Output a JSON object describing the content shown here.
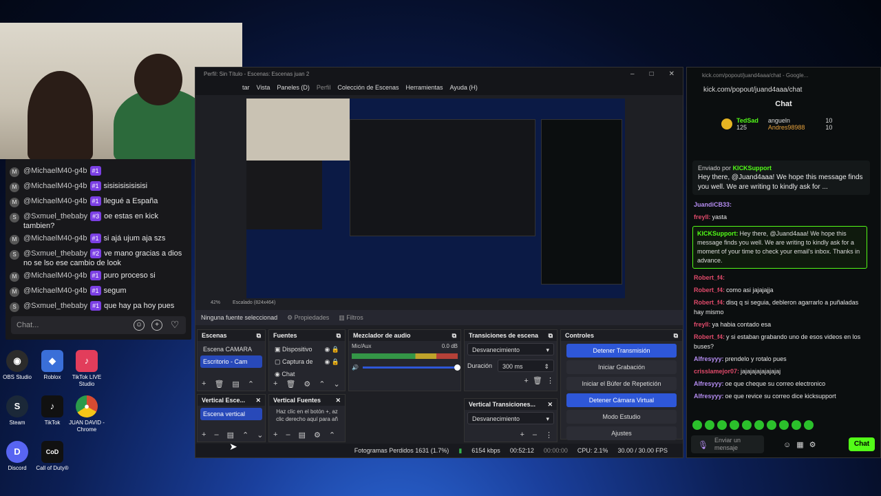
{
  "left_chat": {
    "messages": [
      {
        "user": "@MichaelM40-g4b",
        "badge": "#1",
        "text": ""
      },
      {
        "user": "@MichaelM40-g4b",
        "badge": "#1",
        "text": "sisisisisisisisi"
      },
      {
        "user": "@MichaelM40-g4b",
        "badge": "#1",
        "text": "llegué a España"
      },
      {
        "user": "@Sxmuel_thebaby",
        "badge": "#3",
        "text": "oe estas en kick tambien?"
      },
      {
        "user": "@MichaelM40-g4b",
        "badge": "#1",
        "text": "si ajá ujum aja szs"
      },
      {
        "user": "@Sxmuel_thebaby",
        "badge": "#2",
        "text": "ve mano gracias a dios no se lso ese cambio de look"
      },
      {
        "user": "@MichaelM40-g4b",
        "badge": "#1",
        "text": "puro proceso si"
      },
      {
        "user": "@MichaelM40-g4b",
        "badge": "#1",
        "text": "segum"
      },
      {
        "user": "@Sxmuel_thebaby",
        "badge": "#1",
        "text": "que hay pa hoy pues"
      }
    ],
    "input_placeholder": "Chat..."
  },
  "desktop_icons": [
    {
      "label": "OBS Studio",
      "glyph": "◉",
      "color": "#2b2b2b"
    },
    {
      "label": "Roblox",
      "glyph": "◆",
      "color": "#3a6fd8"
    },
    {
      "label": "TikTok LIVE Studio",
      "glyph": "♪",
      "color": "#e23d5b"
    },
    {
      "label": "Steam",
      "glyph": "S",
      "color": "#1b2838"
    },
    {
      "label": "TikTok",
      "glyph": "♪",
      "color": "#111"
    },
    {
      "label": "JUAN DAVID - Chrome",
      "glyph": "●",
      "color": "#d64b32"
    },
    {
      "label": "Discord",
      "glyph": "D",
      "color": "#5865f2"
    },
    {
      "label": "Call of Duty®",
      "glyph": "CoD",
      "color": "#111"
    }
  ],
  "obs": {
    "title": "Perfil: Sin Título - Escenas: Escenas juan 2",
    "menu": [
      "tar",
      "Vista",
      "Paneles (D)",
      "Perfil",
      "Colección de Escenas",
      "Herramientas",
      "Ayuda (H)"
    ],
    "zoom": "42%",
    "scale": "Escalado (824x464)",
    "no_source": "Ninguna fuente seleccionad",
    "properties": "Propiedades",
    "filters": "Filtros",
    "scenes": {
      "title": "Escenas",
      "items": [
        "Escena CAMARA",
        "Escritorio - Cam"
      ],
      "selected": 1
    },
    "sources": {
      "title": "Fuentes",
      "items": [
        "Dispositivo",
        "Captura de",
        "Chat"
      ]
    },
    "mixer": {
      "title": "Mezclador de audio",
      "channel": "Mic/Aux",
      "db": "0.0 dB"
    },
    "transitions": {
      "title": "Transiciones de escena",
      "type": "Desvanecimiento",
      "duration_label": "Duración",
      "duration": "300 ms"
    },
    "controls": {
      "title": "Controles",
      "buttons": [
        "Detener Transmisión",
        "Iniciar Grabación",
        "Iniciar el Búfer de Repetición",
        "Detener Cámara Virtual",
        "Modo Estudio",
        "Ajustes"
      ]
    },
    "vertical_scenes": {
      "title": "Vertical Esce...",
      "item": "Escena vertical"
    },
    "vertical_sources": {
      "title": "Vertical Fuentes",
      "hint": "Haz clic en el botón +, az clic derecho aquí para añ"
    },
    "vertical_transitions": {
      "title": "Vertical Transiciones...",
      "type": "Desvanecimiento"
    },
    "status": {
      "dropped": "Fotogramas Perdidos 1631 (1.7%)",
      "kbps": "6154 kbps",
      "live_time": "00:52:12",
      "rec_time": "00:00:00",
      "cpu": "CPU: 2.1%",
      "fps": "30.00 / 30.00 FPS"
    }
  },
  "kick": {
    "window_title": "kick.com/popout/juand4aaa/chat - Google...",
    "url": "kick.com/popout/juand4aaa/chat",
    "header": "Chat",
    "top_user": "TedSad",
    "top_count": "125",
    "gifter1": "angueln",
    "gifter1_count": "10",
    "gifter2": "Andres98988",
    "gifter2_count": "10",
    "pinned_by": "Enviado por",
    "pinned_user": "KICKSupport",
    "pinned_text": "Hey there, @Juand4aaa! We hope this message finds you well. We are writing to kindly ask for ...",
    "messages": [
      {
        "user": "JuandiCB33:",
        "text": "",
        "cls": "purple"
      },
      {
        "user": "freyll:",
        "text": "yasta",
        "cls": ""
      },
      {
        "user": "Robert_f4:",
        "text": "",
        "cls": ""
      },
      {
        "user": "Robert_f4:",
        "text": "como asi jajajajja",
        "cls": ""
      },
      {
        "user": "Robert_f4:",
        "text": "disq q si seguia, debleron agarrarlo a puñaladas hay mismo",
        "cls": ""
      },
      {
        "user": "freyll:",
        "text": "ya habia contado esa",
        "cls": ""
      },
      {
        "user": "Robert_f4:",
        "text": "y si estaban grabando uno de esos videos en los buses?",
        "cls": ""
      },
      {
        "user": "Alfresyyy:",
        "text": "prendelo y rotalo pues",
        "cls": "purple"
      },
      {
        "user": "crisslamejor07:",
        "text": "jajajajajajajajaj",
        "cls": ""
      },
      {
        "user": "Alfresyyy:",
        "text": "oe que cheque su correo electronico",
        "cls": "purple"
      },
      {
        "user": "Alfresyyy:",
        "text": "oe que revice su correo dice kicksupport",
        "cls": "purple"
      }
    ],
    "highlight_user": "KICKSupport:",
    "highlight_text": "Hey there, @Juand4aaa! We hope this message finds you well. We are writing to kindly ask for a moment of your time to check your email's inbox. Thanks in advance.",
    "input_placeholder": "Enviar un mensaje",
    "send": "Chat"
  }
}
